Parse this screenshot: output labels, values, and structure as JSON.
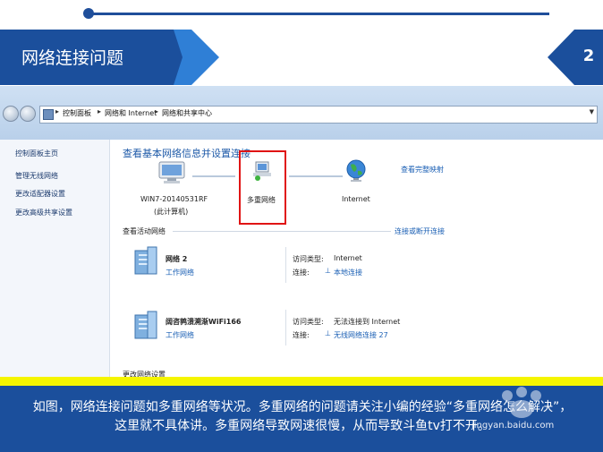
{
  "slide": {
    "title": "网络连接问题",
    "page_number": "2",
    "caption_line1": "如图，网络连接问题如多重网络等状况。多重网络的问题请关注小编的经验“多重网络怎么解决”，",
    "caption_line2": "这里就不具体讲。多重网络导致网速很慢，从而导致斗鱼tv打不开。"
  },
  "address_bar": {
    "crumbs": [
      "控制面板",
      "网络和 Internet",
      "网络和共享中心"
    ]
  },
  "left_pane": {
    "items": [
      "控制面板主页",
      "管理无线网络",
      "更改适配器设置",
      "更改高级共享设置"
    ]
  },
  "main": {
    "heading": "查看基本网络信息并设置连接",
    "view_full_map": "查看完整映射",
    "computer_name": "WIN7-20140531RF",
    "computer_sub": "(此计算机)",
    "multi_network": "多重网络",
    "internet": "Internet",
    "active_networks": "查看活动网络",
    "connect_disconnect": "连接或断开连接",
    "networks": [
      {
        "name": "网络  2",
        "type": "工作网络",
        "access_label": "访问类型:",
        "access_value": "Internet",
        "conn_label": "连接:",
        "conn_value": "本地连接"
      },
      {
        "name": "阔咨鹑溃溯渐WiFi166",
        "type": "工作网络",
        "access_label": "访问类型:",
        "access_value": "无法连接到 Internet",
        "conn_label": "连接:",
        "conn_value": "无线网络连接 27"
      }
    ],
    "change_settings": "更改网络设置"
  },
  "watermark": {
    "text": "jingyan.baidu.com"
  },
  "colors": {
    "banner_dark": "#1b4f9c",
    "banner_light": "#2f7fd6",
    "caption_bg": "#1b4f9c",
    "yellow_bar": "#f5f500",
    "highlight": "#e01414"
  }
}
